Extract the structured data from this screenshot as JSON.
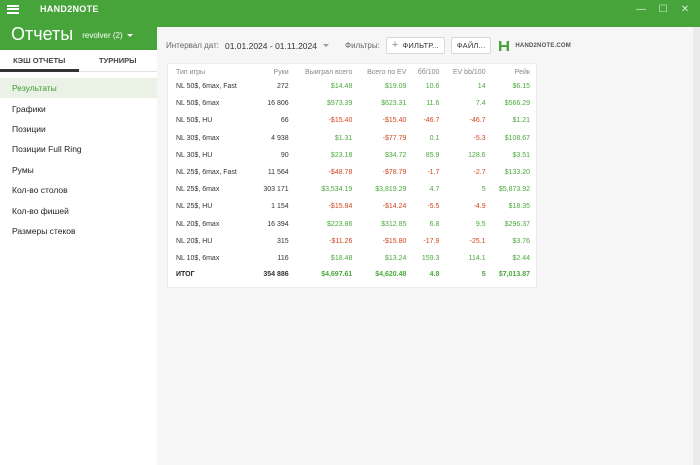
{
  "app": {
    "name": "HAND2NOTE",
    "window_controls": [
      "—",
      "☐",
      "✕"
    ]
  },
  "header": {
    "title": "Отчеты",
    "account": "revolver (2)"
  },
  "sidebar": {
    "tabs": [
      {
        "label": "КЭШ ОТЧЕТЫ",
        "active": true
      },
      {
        "label": "ТУРНИРЫ",
        "active": false
      }
    ],
    "items": [
      {
        "label": "Результаты",
        "active": true
      },
      {
        "label": "Графики"
      },
      {
        "label": "Позиции"
      },
      {
        "label": "Позиции Full Ring"
      },
      {
        "label": "Румы"
      },
      {
        "label": "Кол-во столов"
      },
      {
        "label": "Кол-во фишей"
      },
      {
        "label": "Размеры стеков"
      }
    ]
  },
  "toolbar": {
    "interval_label": "Интервал дат:",
    "date_range": "01.01.2024 - 01.11.2024",
    "filters_label": "Фильтры:",
    "filter_button": "ФИЛЬТР...",
    "file_button": "ФАЙЛ...",
    "logo_text": "HAND2NOTE.COM"
  },
  "colors": {
    "accent": "#46a43a",
    "positive": "#4aa83c",
    "negative": "#d0461e"
  },
  "table": {
    "columns": [
      "Тип игры",
      "Руки",
      "Выиграл всего",
      "Всего по EV",
      "бб/100",
      "EV bb/100",
      "Рейк"
    ],
    "rows": [
      {
        "cells": [
          "NL 50$, 6max, Fast",
          "272",
          "$14.48",
          "$19.09",
          "10.6",
          "14",
          "$6.15"
        ],
        "signs": [
          "",
          "",
          "pos",
          "pos",
          "pos",
          "pos",
          "pos"
        ]
      },
      {
        "cells": [
          "NL 50$, 6max",
          "16 806",
          "$973.39",
          "$623.31",
          "11.6",
          "7.4",
          "$566.29"
        ],
        "signs": [
          "",
          "",
          "pos",
          "pos",
          "pos",
          "pos",
          "pos"
        ]
      },
      {
        "cells": [
          "NL 50$, HU",
          "66",
          "-$15.40",
          "-$15.40",
          "-46.7",
          "-46.7",
          "$1.21"
        ],
        "signs": [
          "",
          "",
          "neg",
          "neg",
          "neg",
          "neg",
          "pos"
        ]
      },
      {
        "cells": [
          "NL 30$, 6max",
          "4 938",
          "$1.31",
          "-$77.79",
          "0.1",
          "-5.3",
          "$108.67"
        ],
        "signs": [
          "",
          "",
          "pos",
          "neg",
          "pos",
          "neg",
          "pos"
        ]
      },
      {
        "cells": [
          "NL 30$, HU",
          "90",
          "$23.18",
          "$34.72",
          "85.9",
          "128.6",
          "$3.51"
        ],
        "signs": [
          "",
          "",
          "pos",
          "pos",
          "pos",
          "pos",
          "pos"
        ]
      },
      {
        "cells": [
          "NL 25$, 6max, Fast",
          "11 564",
          "-$48.78",
          "-$78.79",
          "-1.7",
          "-2.7",
          "$133.20"
        ],
        "signs": [
          "",
          "",
          "neg",
          "neg",
          "neg",
          "neg",
          "pos"
        ]
      },
      {
        "cells": [
          "NL 25$, 6max",
          "303 171",
          "$3,534.19",
          "$3,819.29",
          "4.7",
          "5",
          "$5,873.92"
        ],
        "signs": [
          "",
          "",
          "pos",
          "pos",
          "pos",
          "pos",
          "pos"
        ]
      },
      {
        "cells": [
          "NL 25$, HU",
          "1 154",
          "-$15.84",
          "-$14.24",
          "-5.5",
          "-4.9",
          "$18.35"
        ],
        "signs": [
          "",
          "",
          "neg",
          "neg",
          "neg",
          "neg",
          "pos"
        ]
      },
      {
        "cells": [
          "NL 20$, 6max",
          "16 394",
          "$223.86",
          "$312.85",
          "6.8",
          "9.5",
          "$296.37"
        ],
        "signs": [
          "",
          "",
          "pos",
          "pos",
          "pos",
          "pos",
          "pos"
        ]
      },
      {
        "cells": [
          "NL 20$, HU",
          "315",
          "-$11.26",
          "-$15.80",
          "-17.9",
          "-25.1",
          "$3.76"
        ],
        "signs": [
          "",
          "",
          "neg",
          "neg",
          "neg",
          "neg",
          "pos"
        ]
      },
      {
        "cells": [
          "NL 10$, 6max",
          "116",
          "$18.48",
          "$13.24",
          "159.3",
          "114.1",
          "$2.44"
        ],
        "signs": [
          "",
          "",
          "pos",
          "pos",
          "pos",
          "pos",
          "pos"
        ]
      }
    ],
    "total": {
      "cells": [
        "ИТОГ",
        "354 886",
        "$4,697.61",
        "$4,620.48",
        "4.8",
        "5",
        "$7,013.87"
      ],
      "signs": [
        "",
        "",
        "pos",
        "pos",
        "pos",
        "pos",
        "pos"
      ]
    }
  }
}
